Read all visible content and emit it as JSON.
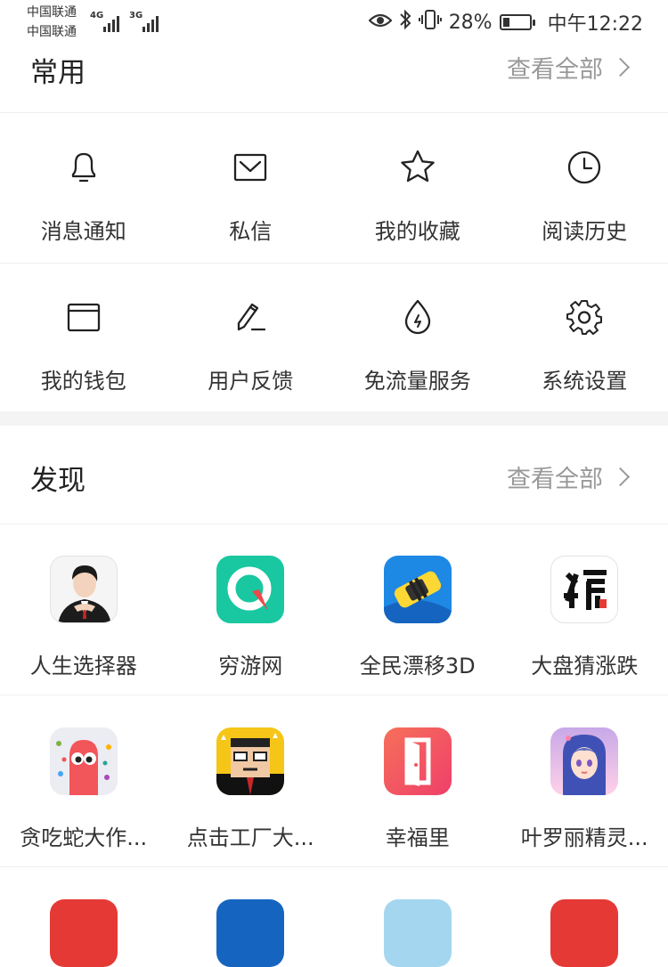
{
  "status_bar": {
    "carrier_1": "中国联通",
    "carrier_2": "中国联通",
    "net_1": "4G",
    "net_2": "3G",
    "battery_percent": "28%",
    "battery_level": 0.28,
    "time": "中午12:22",
    "icons": [
      "eye-icon",
      "bluetooth-icon",
      "vibrate-icon",
      "battery-icon"
    ]
  },
  "common": {
    "title": "常用",
    "view_all": "查看全部",
    "items": [
      {
        "label": "消息通知",
        "icon": "bell-icon"
      },
      {
        "label": "私信",
        "icon": "mail-icon"
      },
      {
        "label": "我的收藏",
        "icon": "star-icon"
      },
      {
        "label": "阅读历史",
        "icon": "clock-icon"
      },
      {
        "label": "我的钱包",
        "icon": "wallet-icon"
      },
      {
        "label": "用户反馈",
        "icon": "pencil-icon"
      },
      {
        "label": "免流量服务",
        "icon": "drop-icon"
      },
      {
        "label": "系统设置",
        "icon": "gear-icon"
      }
    ]
  },
  "discover": {
    "title": "发现",
    "view_all": "查看全部",
    "apps": [
      {
        "label": "人生选择器",
        "icon": "life-chooser-app-icon",
        "color": "#f5f5f5"
      },
      {
        "label": "穷游网",
        "icon": "qyer-app-icon",
        "color": "#19c7a0"
      },
      {
        "label": "全民漂移3D",
        "icon": "drift-car-app-icon",
        "color": "#1e88e5"
      },
      {
        "label": "大盘猜涨跌",
        "icon": "stock-guess-app-icon",
        "color": "#ffffff"
      },
      {
        "label": "贪吃蛇大作...",
        "icon": "snake-app-icon",
        "color": "#ececf3"
      },
      {
        "label": "点击工厂大...",
        "icon": "click-factory-app-icon",
        "color": "#f5c518"
      },
      {
        "label": "幸福里",
        "icon": "xingfuli-app-icon",
        "color": "#f2555a"
      },
      {
        "label": "叶罗丽精灵...",
        "icon": "yeloli-app-icon",
        "color": "#c8a8e8"
      }
    ],
    "partial_row_colors": [
      "#e53935",
      "#1565c0",
      "#a5d6f0",
      "#e53935"
    ]
  }
}
